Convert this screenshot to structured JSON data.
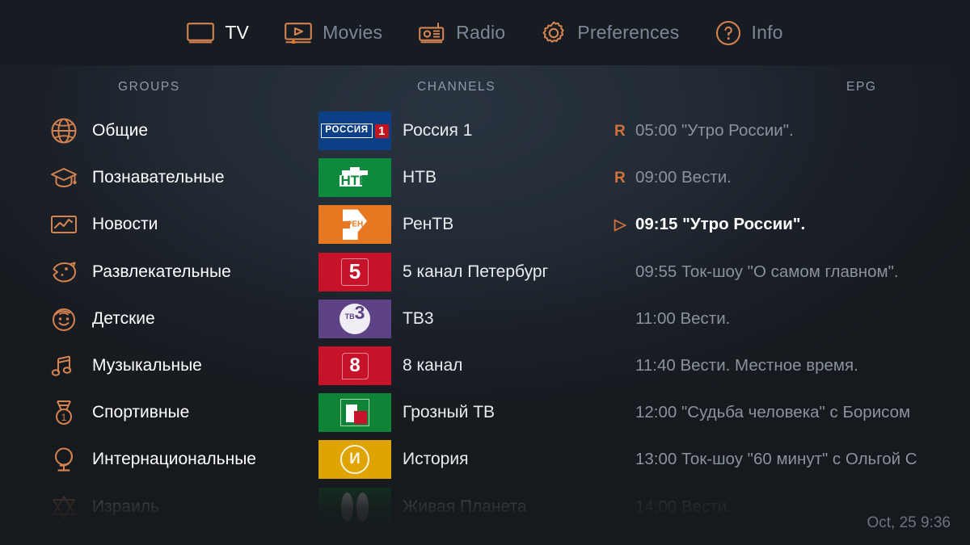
{
  "nav": {
    "items": [
      {
        "label": "TV",
        "icon": "tv-icon",
        "active": true
      },
      {
        "label": "Movies",
        "icon": "movies-icon",
        "active": false
      },
      {
        "label": "Radio",
        "icon": "radio-icon",
        "active": false
      },
      {
        "label": "Preferences",
        "icon": "gear-icon",
        "active": false
      },
      {
        "label": "Info",
        "icon": "question-mark-icon",
        "active": false
      }
    ]
  },
  "headers": {
    "groups": "GROUPS",
    "channels": "CHANNELS",
    "epg": "EPG"
  },
  "groups": {
    "items": [
      {
        "label": "Общие",
        "icon": "globe-icon"
      },
      {
        "label": "Познавательные",
        "icon": "graduation-cap-icon"
      },
      {
        "label": "Новости",
        "icon": "news-chart-icon"
      },
      {
        "label": "Развлекательные",
        "icon": "comedy-bird-icon"
      },
      {
        "label": "Детские",
        "icon": "child-face-icon"
      },
      {
        "label": "Музыкальные",
        "icon": "music-note-icon"
      },
      {
        "label": "Спортивные",
        "icon": "medal-icon"
      },
      {
        "label": "Интернациональные",
        "icon": "desk-globe-icon"
      },
      {
        "label": "Израиль",
        "icon": "star-of-david-icon"
      }
    ]
  },
  "channels": {
    "items": [
      {
        "label": "Россия 1",
        "logo": "rossiya-1-logo"
      },
      {
        "label": "НТВ",
        "logo": "ntv-logo"
      },
      {
        "label": "РенТВ",
        "logo": "ren-tv-logo"
      },
      {
        "label": "5 канал Петербург",
        "logo": "5-kanal-logo"
      },
      {
        "label": "ТВ3",
        "logo": "tv3-logo"
      },
      {
        "label": "8 канал",
        "logo": "8-kanal-logo"
      },
      {
        "label": "Грозный ТВ",
        "logo": "grozny-tv-logo"
      },
      {
        "label": "История",
        "logo": "istoria-logo"
      },
      {
        "label": "Живая Планета",
        "logo": "zhivaya-planeta-logo"
      }
    ]
  },
  "epg": {
    "items": [
      {
        "mark": "R",
        "text": "05:00 \"Утро России\".",
        "state": "recorded"
      },
      {
        "mark": "R",
        "text": "09:00 Вести.",
        "state": "recorded"
      },
      {
        "mark": "▷",
        "text": "09:15 \"Утро России\".",
        "state": "now"
      },
      {
        "mark": "",
        "text": "09:55 Ток-шоу \"О самом главном\".",
        "state": "upcoming"
      },
      {
        "mark": "",
        "text": "11:00 Вести.",
        "state": "upcoming"
      },
      {
        "mark": "",
        "text": "11:40 Вести. Местное время.",
        "state": "upcoming"
      },
      {
        "mark": "",
        "text": "12:00 \"Судьба человека\" с Борисом",
        "state": "upcoming"
      },
      {
        "mark": "",
        "text": "13:00 Ток-шоу \"60 минут\" с Ольгой С",
        "state": "upcoming"
      },
      {
        "mark": "",
        "text": "14:00 Вести.",
        "state": "upcoming"
      }
    ]
  },
  "status": {
    "clock": "Oct, 25 9:36"
  },
  "colors": {
    "accent": "#d4713a",
    "active_text": "#ffffff",
    "inactive_text": "#7c8795",
    "muted_text": "#8a929c",
    "topbar_bg": "#171c23",
    "page_bg": "#16191d"
  }
}
